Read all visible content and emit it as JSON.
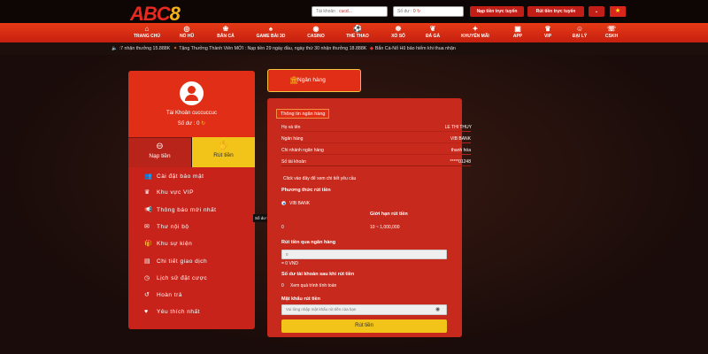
{
  "header": {
    "logo_text": "ABC",
    "logo_number": "8",
    "username_placeholder": "Tài khoản :",
    "username_value": "cucd...",
    "balance_label": "Số dư :",
    "balance_value": "0",
    "deposit_button": "Nạp tiền trực tuyến",
    "withdraw_button": "Rút tiền trực tuyến",
    "menu_icon": "chevron-down-icon",
    "flag": "★"
  },
  "nav": {
    "items": [
      {
        "label": "TRANG CHỦ",
        "icon": "⌂"
      },
      {
        "label": "NỔ HŨ",
        "icon": "◎"
      },
      {
        "label": "BẮN CÁ",
        "icon": "❀"
      },
      {
        "label": "GAME BÀI 3D",
        "icon": "♠"
      },
      {
        "label": "CASINO",
        "icon": "◉"
      },
      {
        "label": "THỂ THAO",
        "icon": "⚽"
      },
      {
        "label": "XỔ SỐ",
        "icon": "☸"
      },
      {
        "label": "ĐÁ GÀ",
        "icon": "❦"
      },
      {
        "label": "KHUYẾN MÃI",
        "icon": "✦"
      },
      {
        "label": "APP",
        "icon": "▣"
      },
      {
        "label": "VIP",
        "icon": "♛"
      },
      {
        "label": "ĐẠI LÝ",
        "icon": "☺"
      },
      {
        "label": "CSKH",
        "icon": "☏"
      }
    ]
  },
  "ticker": {
    "speaker_icon": "🔈",
    "text1": ":7 nhận thưởng 15.888K",
    "text2": "Tặng Thưởng Thành Viên MỚI : Nạp tiền 29 ngày đầu, ngày thứ 30 nhận thưởng 18.888K",
    "text3": "Bắn Cá-Nổ Hũ bảo hiểm khi thua nhận"
  },
  "account": {
    "label": "Tài Khoản cuccuccuc",
    "balance": "Số dư : 0",
    "deposit_label": "Nạp tiền",
    "withdraw_label": "Rút tiền"
  },
  "menu": {
    "items": [
      {
        "label": "Cài đặt bảo mật",
        "icon": "👥"
      },
      {
        "label": "Khu vực VIP",
        "icon": "♛"
      },
      {
        "label": "Thông báo mới nhất",
        "icon": "📢"
      },
      {
        "label": "Thư nội bộ",
        "icon": "✉"
      },
      {
        "label": "Khu sự kiện",
        "icon": "🎁"
      },
      {
        "label": "Chi tiết giao dịch",
        "icon": "▤"
      },
      {
        "label": "Lịch sử đặt cược",
        "icon": "◷"
      },
      {
        "label": "Hoàn trả",
        "icon": "↺"
      },
      {
        "label": "Yêu thích nhất",
        "icon": "♥"
      }
    ],
    "tooltip": "Số dư tài khoản không đủ"
  },
  "bank_tab": {
    "label": "Ngân hàng"
  },
  "bank_info": {
    "title": "Thông tin ngân hàng",
    "rows": [
      {
        "key": "Họ và tên",
        "value": "LE THI THUY"
      },
      {
        "key": "Ngân hàng",
        "value": "VIB BANK"
      },
      {
        "key": "Chi nhánh ngân hàng",
        "value": "thanh hóa"
      },
      {
        "key": "Số tài khoản",
        "value": "*****01248"
      }
    ],
    "click_note": "Click vào đây để xem chi tiết yêu cầu"
  },
  "withdraw_form": {
    "method_label": "Phương thức rút tiền",
    "method_value": "VIB BANK",
    "limit_label": "Giới hạn rút tiền",
    "limit_min_value": "0",
    "limit_value": "10 ~ 1,000,000",
    "amount_label": "Rút tiền qua ngân hàng",
    "amount_value": "0",
    "amount_vnd": "= 0 VND",
    "after_label": "Số dư tài khoản sau khi rút tiền",
    "after_value": "0",
    "after_link": "Xem quá trình tính toán",
    "password_label": "Mật khẩu rút tiền",
    "password_placeholder": "Vui lòng nhập mật khẩu rút tiền của bạn",
    "submit_label": "Rút tiền"
  }
}
